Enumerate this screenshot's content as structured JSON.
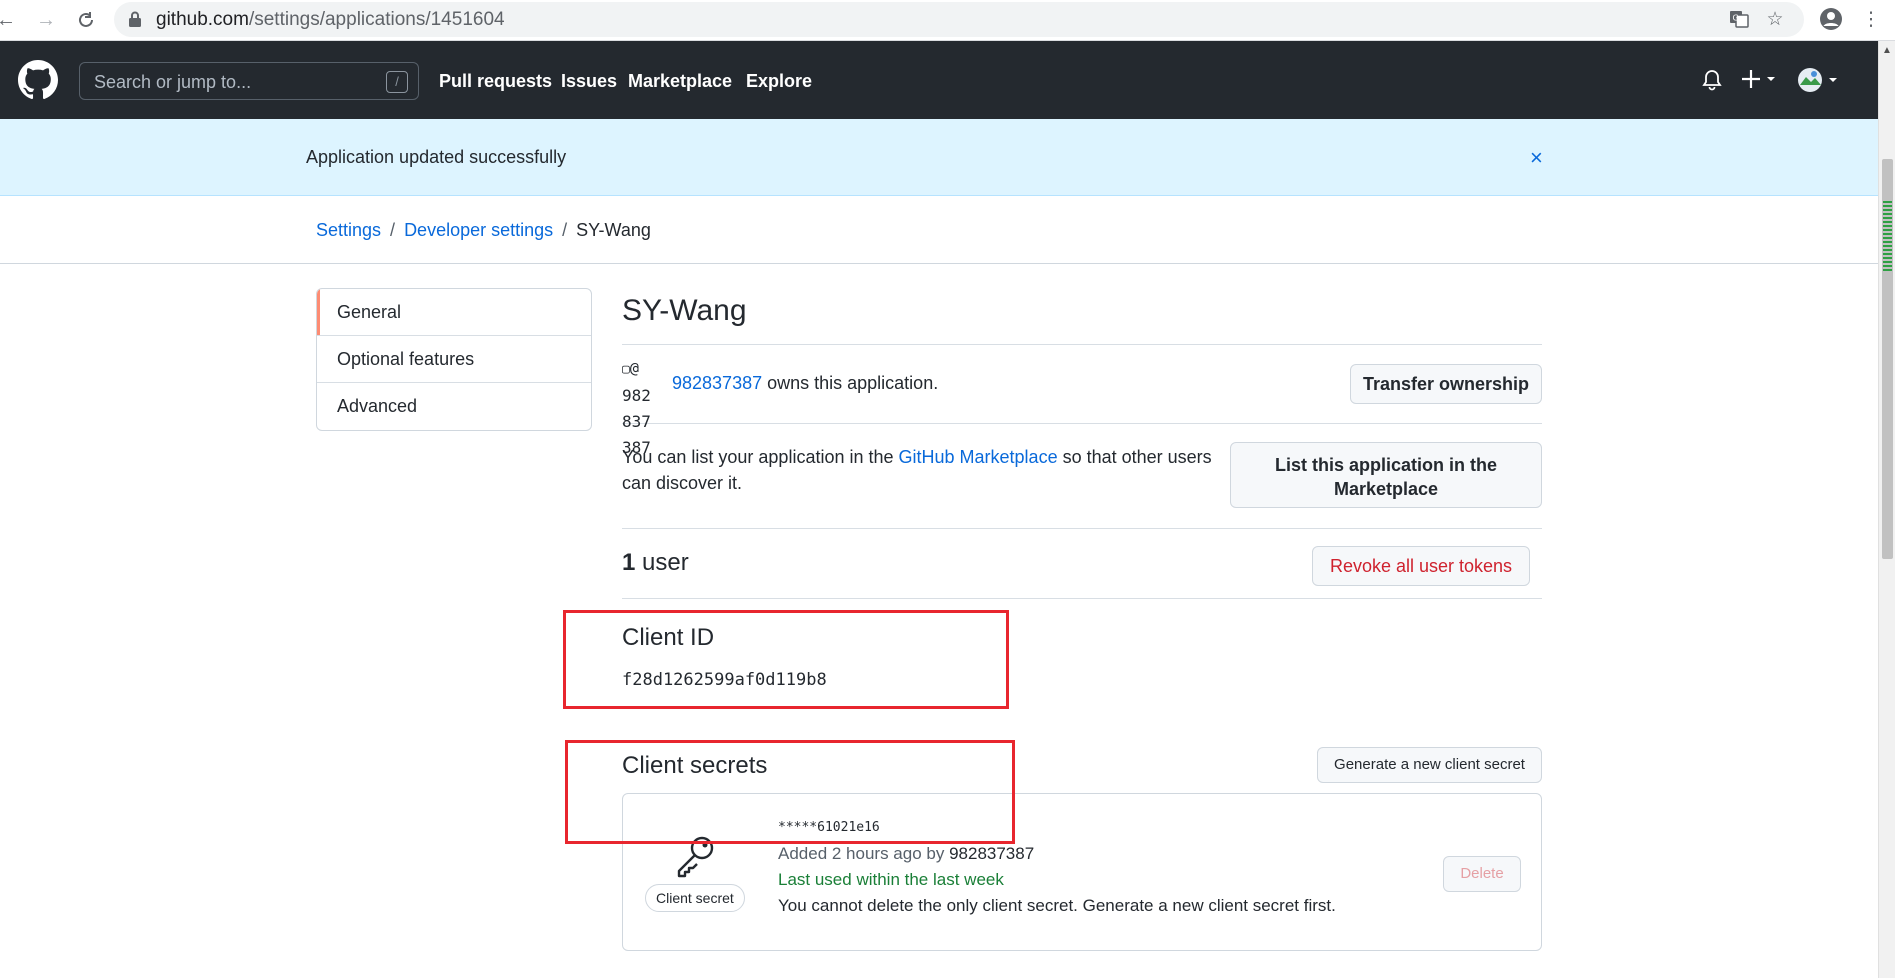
{
  "browser": {
    "url_host": "github.com",
    "url_path": "/settings/applications/1451604"
  },
  "header": {
    "search_placeholder": "Search or jump to...",
    "search_shortcut": "/",
    "nav": [
      "Pull requests",
      "Issues",
      "Marketplace",
      "Explore"
    ]
  },
  "flash": {
    "message": "Application updated successfully",
    "close": "×"
  },
  "breadcrumb": {
    "items": [
      "Settings",
      "Developer settings",
      "SY-Wang"
    ],
    "separator": "/"
  },
  "sidebar": {
    "items": [
      {
        "label": "General",
        "active": true
      },
      {
        "label": "Optional features",
        "active": false
      },
      {
        "label": "Advanced",
        "active": false
      }
    ]
  },
  "app": {
    "title": "SY-Wang",
    "avatar_alt_lines": [
      "@",
      "982",
      "837",
      "387"
    ],
    "avatar_alt_prefix": "▢",
    "owner": "982837387",
    "owner_suffix": " owns this application.",
    "transfer_button": "Transfer ownership",
    "marketplace_text_before": "You can list your application in the ",
    "marketplace_link": "GitHub Marketplace",
    "marketplace_text_after": " so that other users can discover it.",
    "marketplace_button": "List this application in the Marketplace",
    "users_count": "1",
    "users_label": " user",
    "revoke_button": "Revoke all user tokens",
    "client_id_heading": "Client ID",
    "client_id": "f28d1262599af0d119b8",
    "client_secrets_heading": "Client secrets",
    "generate_button": "Generate a new client secret"
  },
  "secret": {
    "label": "Client secret",
    "value": "*****61021e16",
    "added_prefix": "Added 2 hours ago by ",
    "added_by": "982837387",
    "last_used": "Last used within the last week",
    "note": "You cannot delete the only client secret. Generate a new client secret first.",
    "delete_button": "Delete"
  },
  "colors": {
    "header_bg": "#24292f",
    "flash_bg": "#ddf4ff",
    "link": "#0969da",
    "danger": "#cf222e",
    "success": "#1a7f37",
    "annotation_red": "#e8262e"
  }
}
